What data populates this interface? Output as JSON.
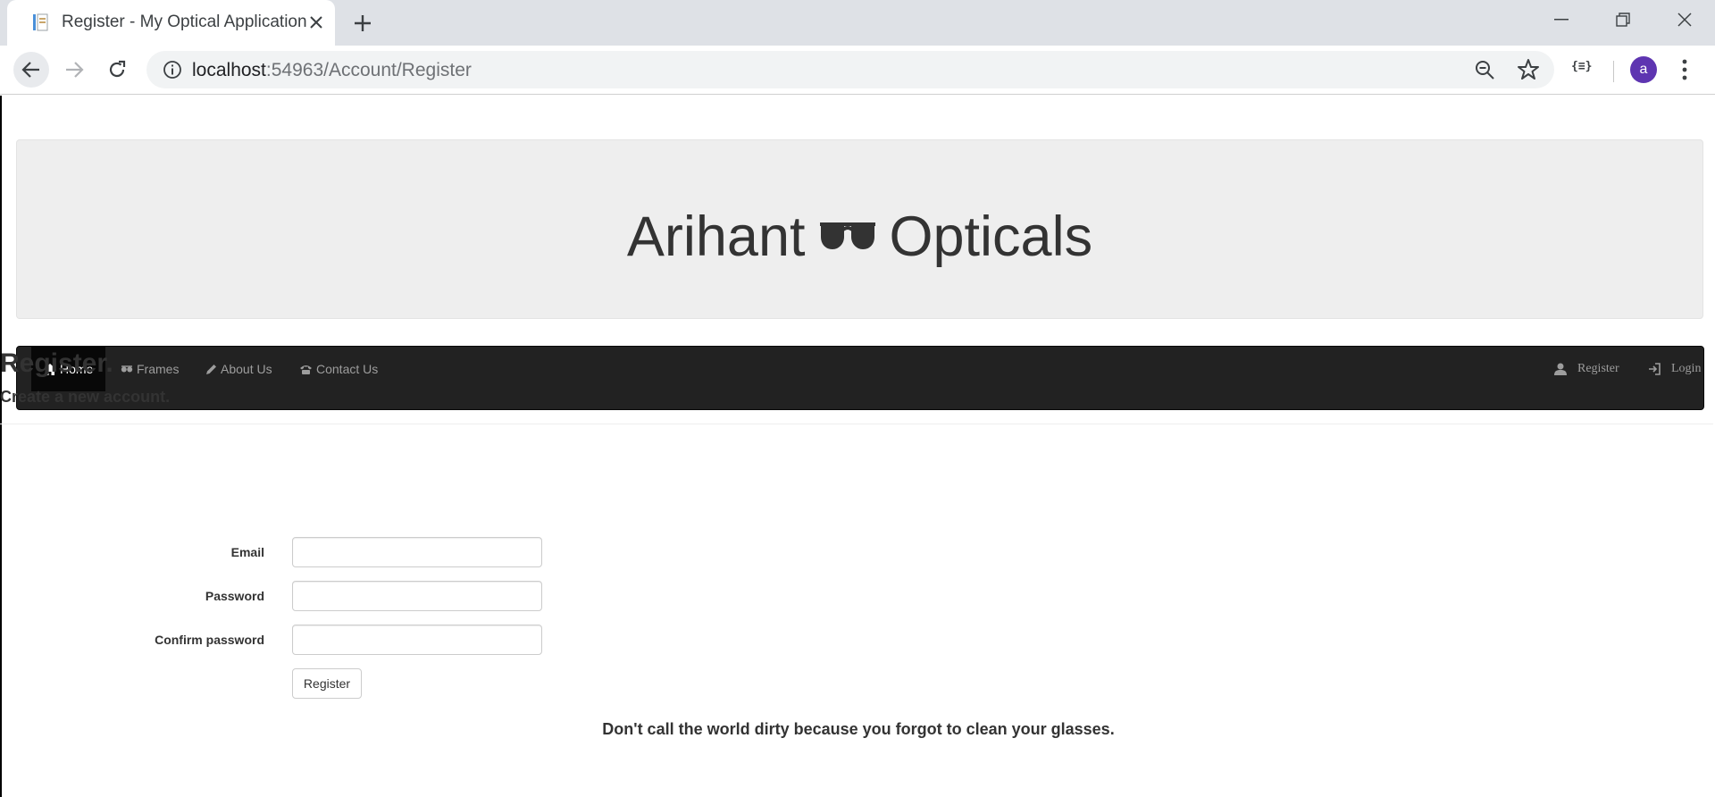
{
  "browser": {
    "tab_title": "Register - My Optical Application",
    "url_host": "localhost",
    "url_path": ":54963/Account/Register",
    "extension_label": "{≡}",
    "avatar_letter": "a"
  },
  "site": {
    "brand_left": "Arihant",
    "brand_right": "Opticals",
    "brand_icon": "sunglasses-icon"
  },
  "nav": {
    "items": [
      {
        "label": "Home",
        "icon": "home-icon",
        "active": true
      },
      {
        "label": "Frames",
        "icon": "glasses-icon"
      },
      {
        "label": "About Us",
        "icon": "pencil-icon"
      },
      {
        "label": "Contact Us",
        "icon": "phone-icon"
      }
    ],
    "right": [
      {
        "label": "Register",
        "icon": "user-icon"
      },
      {
        "label": "Login",
        "icon": "login-icon"
      }
    ]
  },
  "form": {
    "title": "Register.",
    "subtitle": "Create a new account.",
    "email_label": "Email",
    "email_value": "",
    "password_label": "Password",
    "password_value": "",
    "confirm_label": "Confirm password",
    "confirm_value": "",
    "submit_label": "Register"
  },
  "footer": {
    "quote": "Don't call the world dirty because you forgot to clean your glasses."
  },
  "colors": {
    "navbar_bg": "#222222",
    "jumbotron_bg": "#eeeeee",
    "avatar_bg": "#5e35b1"
  }
}
